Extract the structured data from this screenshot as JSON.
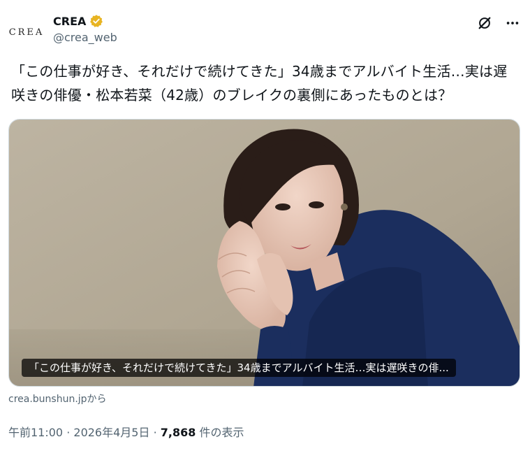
{
  "account": {
    "avatar_text": "CREA",
    "display_name": "CREA",
    "handle": "@crea_web",
    "verified_icon": "verified-badge-gold",
    "verified_color": "#e8b422"
  },
  "header_actions": {
    "grok_icon": "grok-icon",
    "more_icon": "more-icon"
  },
  "tweet": {
    "text": "「この仕事が好き、それだけで続けてきた」34歳までアルバイト生活…実は遅咲きの俳優・松本若菜（42歳）のブレイクの裏側にあったものとは？"
  },
  "card": {
    "caption": "「この仕事が好き、それだけで続けてきた」34歳までアルバイト生活…実は遅咲きの俳...",
    "source": "crea.bunshun.jpから"
  },
  "meta": {
    "time": "午前11:00",
    "separator1": " · ",
    "date": "2026年4月5日",
    "separator2": " · ",
    "views_count": "7,868",
    "views_label": " 件の表示"
  },
  "colors": {
    "text_primary": "#0f1419",
    "text_secondary": "#536471",
    "photo_background": "#b5ab98",
    "sweater": "#1b2e5e"
  }
}
